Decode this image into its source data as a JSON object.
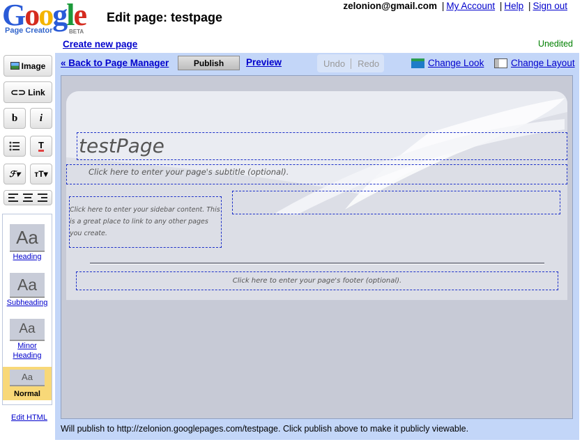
{
  "header": {
    "logo_text": "Google",
    "logo_sub": "Page Creator",
    "logo_beta": "BETA",
    "edit_label": "Edit page:",
    "page_name": "testpage",
    "email": "zelonion@gmail.com",
    "my_account": "My Account",
    "help": "Help",
    "sign_out": "Sign out",
    "create_new": "Create new page",
    "status": "Unedited"
  },
  "left_toolbar": {
    "image_label": "Image",
    "link_label": "Link",
    "bold_label": "b",
    "italic_label": "i",
    "styles": [
      {
        "sample": "Aa",
        "label": "Heading"
      },
      {
        "sample": "Aa",
        "label": "Subheading"
      },
      {
        "sample": "Aa",
        "label": "Minor Heading"
      },
      {
        "sample": "Aa",
        "label": "Normal",
        "selected": true
      }
    ],
    "edit_html": "Edit HTML"
  },
  "toolbar": {
    "back": "« Back to Page Manager",
    "publish": "Publish",
    "preview": "Preview",
    "undo": "Undo",
    "redo": "Redo",
    "change_look": "Change Look",
    "change_layout": "Change Layout"
  },
  "page": {
    "title": "testPage",
    "subtitle_placeholder": "Click here to enter your page's subtitle (optional).",
    "sidebar_placeholder": "Click here to enter your sidebar content. This is a great place to link to any other pages you create.",
    "footer_placeholder": "Click here to enter your page's footer (optional)."
  },
  "publish_note": "Will publish to http://zelonion.googlepages.com/testpage. Click publish above to make it publicly viewable.",
  "colors": {
    "accent_blue": "#0000cc",
    "toolbar_bg": "#c3d6f8",
    "unedited_green": "#008000",
    "normal_style_highlight": "#f8d878"
  }
}
